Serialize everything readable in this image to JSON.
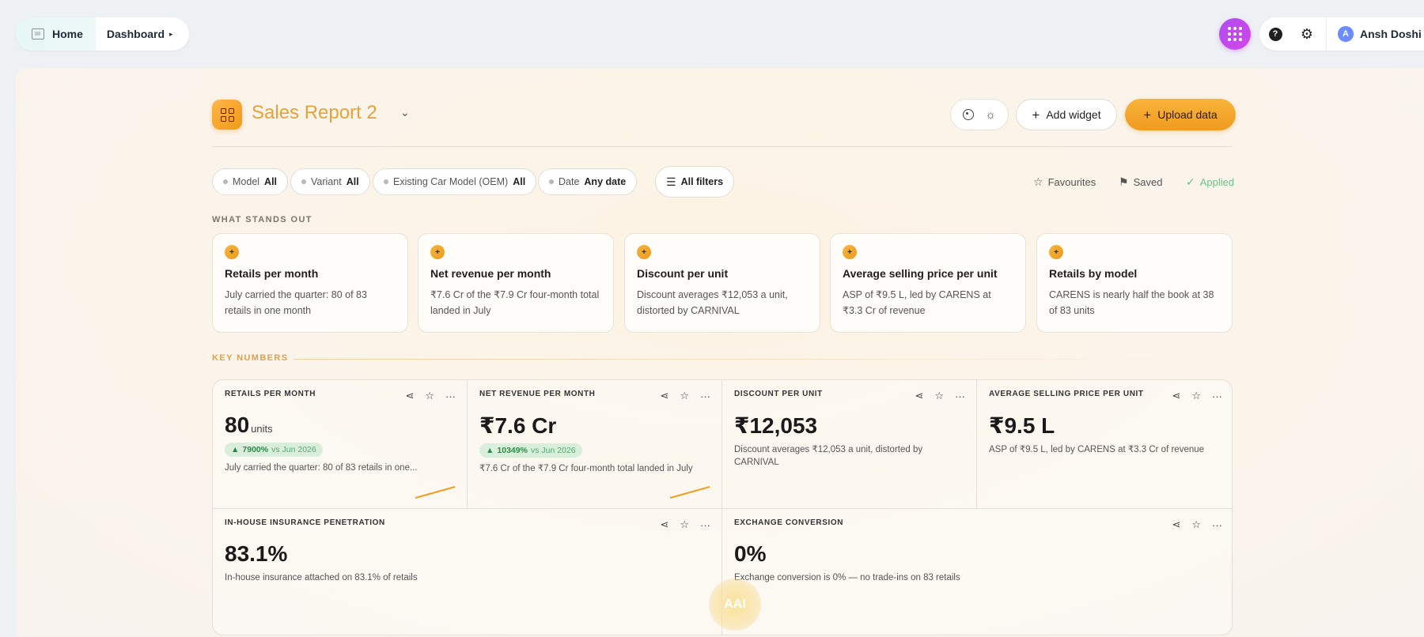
{
  "topbar": {
    "home_label": "Home",
    "dashboard_label": "Dashboard",
    "user_initial": "A",
    "user_name": "Ansh Doshi"
  },
  "header": {
    "title": "Sales Report 2",
    "add_widget_label": "Add widget",
    "upload_label": "Upload data"
  },
  "filters": [
    {
      "name": "Model",
      "value": "All"
    },
    {
      "name": "Variant",
      "value": "All"
    },
    {
      "name": "Existing Car Model (OEM)",
      "value": "All"
    },
    {
      "name": "Date",
      "value": "Any date"
    }
  ],
  "all_filters_label": "All filters",
  "view_options": {
    "favourites": "Favourites",
    "saved": "Saved",
    "applied": "Applied"
  },
  "standout": {
    "label": "WHAT STANDS OUT",
    "cards": [
      {
        "title": "Retails per month",
        "text": "July carried the quarter: 80 of 83 retails in one month"
      },
      {
        "title": "Net revenue per month",
        "text": "₹7.6 Cr of the ₹7.9 Cr four-month total landed in July"
      },
      {
        "title": "Discount per unit",
        "text": "Discount averages ₹12,053 a unit, distorted by CARNIVAL"
      },
      {
        "title": "Average selling price per unit",
        "text": "ASP of ₹9.5 L, led by CARENS at ₹3.3 Cr of revenue"
      },
      {
        "title": "Retails by model",
        "text": "CARENS is nearly half the book at 38 of 83 units"
      }
    ]
  },
  "key_numbers": {
    "label": "KEY NUMBERS",
    "metrics": [
      {
        "label": "RETAILS PER MONTH",
        "value": "80",
        "unit": "units",
        "delta": "7900%",
        "delta_ref": "vs Jun 2026",
        "note": "July carried the quarter: 80 of 83 retails in one..."
      },
      {
        "label": "NET REVENUE PER MONTH",
        "value": "₹7.6 Cr",
        "delta": "10349%",
        "delta_ref": "vs Jun 2026",
        "note": "₹7.6 Cr of the ₹7.9 Cr four-month total landed in July"
      },
      {
        "label": "DISCOUNT PER UNIT",
        "value": "₹12,053",
        "note": "Discount averages ₹12,053 a unit, distorted by CARNIVAL"
      },
      {
        "label": "AVERAGE SELLING PRICE PER UNIT",
        "value": "₹9.5 L",
        "note": "ASP of ₹9.5 L, led by CARENS at ₹3.3 Cr of revenue"
      },
      {
        "label": "IN-HOUSE INSURANCE PENETRATION",
        "value": "83.1%",
        "note": "In-house insurance attached on 83.1% of retails"
      },
      {
        "label": "EXCHANGE CONVERSION",
        "value": "0%",
        "note": "Exchange conversion is 0% — no trade-ins on 83 retails"
      }
    ]
  },
  "ai_button_label": "AAI",
  "colors": {
    "accent": "#f5a623",
    "title": "#e8a23a",
    "positive": "#2c8a47",
    "apps": "#c04cf0"
  }
}
